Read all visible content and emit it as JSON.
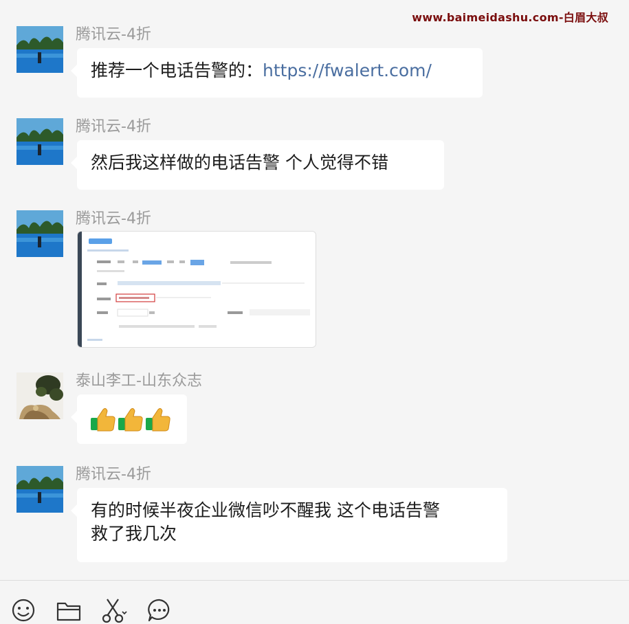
{
  "watermark": "www.baimeidashu.com-白眉大叔",
  "messages": [
    {
      "sender": "腾讯云-4折",
      "text": "推荐一个电话告警的：",
      "link": "https://fwalert.com/"
    },
    {
      "sender": "腾讯云-4折",
      "text": "然后我这样做的电话告警  个人觉得不错"
    },
    {
      "sender": "腾讯云-4折",
      "image": "screenshot-thumbnail"
    },
    {
      "sender": "泰山李工-山东众志",
      "emoji": "thumbs-up-icon x3"
    },
    {
      "sender": "腾讯云-4折",
      "line1": "有的时候半夜企业微信吵不醒我   这个电话告警",
      "line2": "救了我几次"
    }
  ],
  "colors": {
    "background": "#f5f5f5",
    "bubble": "#ffffff",
    "link": "#4a6ea0",
    "sender": "#9a9a9a",
    "watermark": "#7a0d0d"
  },
  "toolbar": [
    "emoji-icon",
    "folder-icon",
    "scissors-icon",
    "chat-more-icon"
  ]
}
